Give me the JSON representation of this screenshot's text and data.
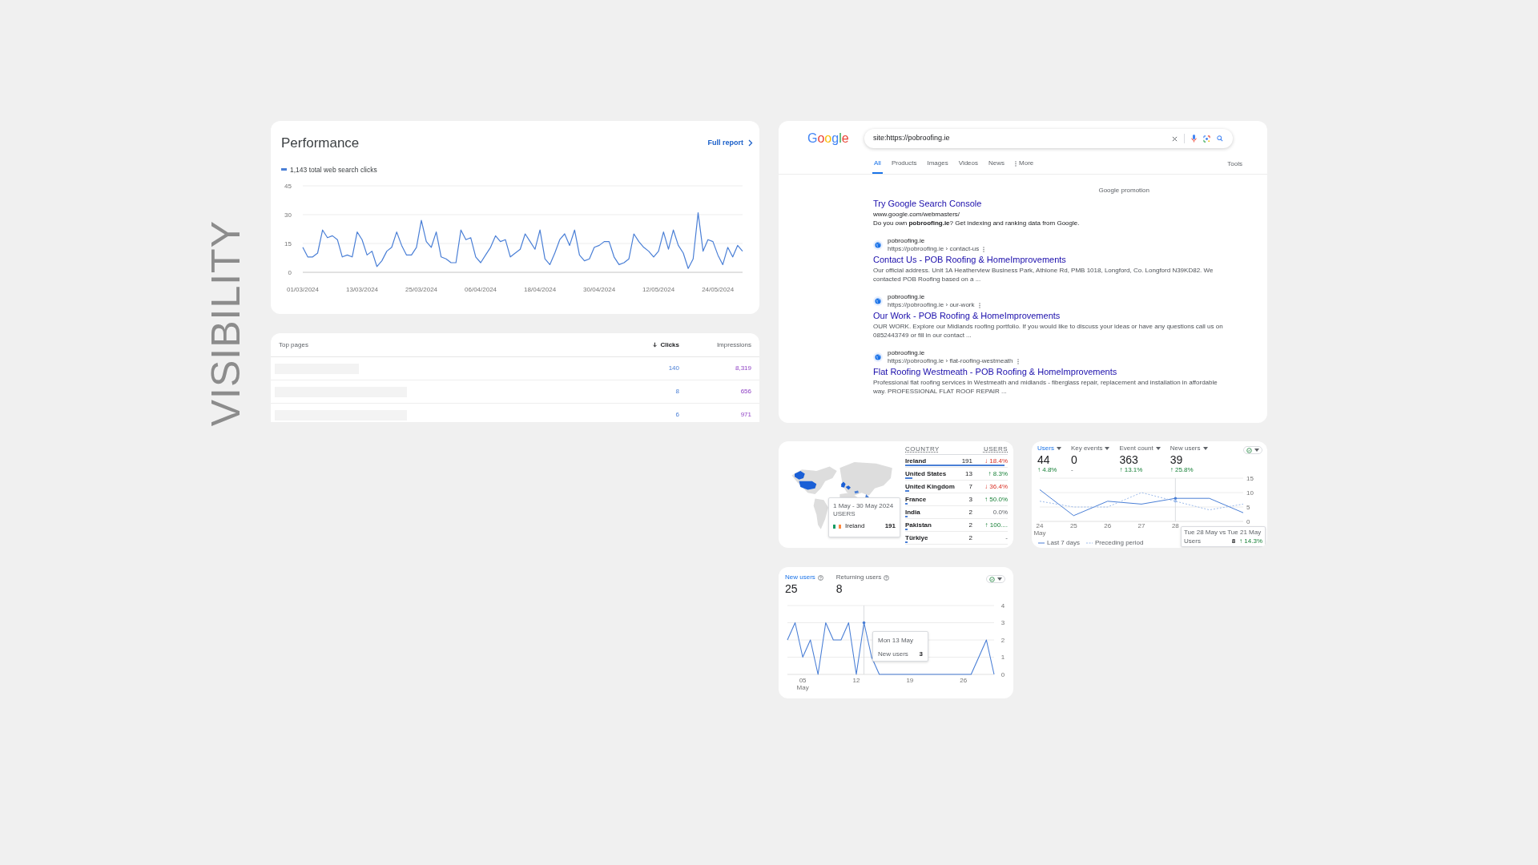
{
  "heading": "VISIBILITY",
  "performance": {
    "title": "Performance",
    "link": "Full report",
    "legend": "1,143 total web search clicks",
    "chart_data": {
      "type": "line",
      "grid": true,
      "categories": [
        "01/03/2024",
        null,
        null,
        null,
        null,
        null,
        null,
        null,
        null,
        null,
        null,
        null,
        "13/03/2024",
        null,
        null,
        null,
        null,
        null,
        null,
        null,
        null,
        null,
        null,
        null,
        "25/03/2024",
        null,
        null,
        null,
        null,
        null,
        null,
        null,
        null,
        null,
        null,
        null,
        "06/04/2024",
        null,
        null,
        null,
        null,
        null,
        null,
        null,
        null,
        null,
        null,
        null,
        "18/04/2024",
        null,
        null,
        null,
        null,
        null,
        null,
        null,
        null,
        null,
        null,
        null,
        "30/04/2024",
        null,
        null,
        null,
        null,
        null,
        null,
        null,
        null,
        null,
        null,
        null,
        "12/05/2024",
        null,
        null,
        null,
        null,
        null,
        null,
        null,
        null,
        null,
        null,
        null,
        "24/05/2024",
        null,
        null,
        null,
        null,
        null
      ],
      "series": [
        {
          "color": "#4a7fd6",
          "values": [
            13,
            8,
            8,
            10,
            22,
            18,
            19,
            17,
            8,
            9,
            8,
            21,
            17,
            9,
            11,
            3,
            6,
            11,
            13,
            21,
            14,
            9,
            9,
            13,
            27,
            16,
            13,
            21,
            8,
            7,
            5,
            5,
            22,
            17,
            18,
            8,
            5,
            9,
            13,
            19,
            16,
            17,
            8,
            10,
            12,
            20,
            16,
            12,
            22,
            7,
            4,
            10,
            17,
            20,
            14,
            22,
            9,
            6,
            7,
            13,
            14,
            16,
            16,
            8,
            4,
            5,
            7,
            20,
            16,
            13,
            11,
            8,
            11,
            21,
            12,
            22,
            14,
            10,
            2,
            7,
            31,
            11,
            17,
            16,
            9,
            4,
            13,
            8,
            14,
            11
          ]
        }
      ],
      "ylim": [
        0,
        45
      ],
      "yticks": [
        0,
        15,
        30,
        45
      ]
    }
  },
  "top_pages": {
    "columns": [
      {
        "label": "Top pages",
        "sorted": false
      },
      {
        "label": "Clicks",
        "sorted": true
      },
      {
        "label": "Impressions",
        "sorted": false
      }
    ],
    "rows": [
      {
        "clicks": "140",
        "impressions": "8,319"
      },
      {
        "clicks": "8",
        "impressions": "656"
      },
      {
        "clicks": "6",
        "impressions": "971"
      }
    ]
  },
  "search": {
    "logo": "Google",
    "query": "site:https://pobroofing.ie",
    "tabs": [
      {
        "label": "All",
        "selected": true,
        "kind": "tab"
      },
      {
        "label": "Products",
        "selected": false,
        "kind": "tab"
      },
      {
        "label": "Images",
        "selected": false,
        "kind": "tab"
      },
      {
        "label": "Videos",
        "selected": false,
        "kind": "tab"
      },
      {
        "label": "News",
        "selected": false,
        "kind": "tab"
      },
      {
        "label": "More",
        "selected": false,
        "kind": "menu"
      }
    ],
    "tools": "Tools",
    "promotion": {
      "label": "Google promotion",
      "title": "Try Google Search Console",
      "url": "www.google.com/webmasters/",
      "snippet": "Do you own **pobroofing.ie**? Get indexing and ranking data from Google."
    },
    "results": [
      {
        "site": "pobroofing.ie",
        "url": "https://pobroofing.ie › contact-us",
        "title": "Contact Us - POB Roofing & HomeImprovements",
        "snippet": "Our official address. Unit 1A Heatherview Business Park, Athlone Rd, PMB 1018, Longford, Co. Longford N39KD82. We contacted POB Roofing based on a ..."
      },
      {
        "site": "pobroofing.ie",
        "url": "https://pobroofing.ie › our-work",
        "title": "Our Work - POB Roofing & HomeImprovements",
        "snippet": "OUR WORK. Explore our Midlands roofing portfolio. If you would like to discuss your ideas or have any questions call us on 0852443749 or fill in our contact ..."
      },
      {
        "site": "pobroofing.ie",
        "url": "https://pobroofing.ie › flat-roofing-westmeath",
        "title": "Flat Roofing Westmeath - POB Roofing & HomeImprovements",
        "snippet": "Professional flat roofing services in Westmeath and midlands - fiberglass repair, replacement and installation in affordable way. PROFESSIONAL FLAT ROOF REPAIR ..."
      }
    ]
  },
  "countries": {
    "columns": [
      "COUNTRY",
      "USERS"
    ],
    "rows": [
      {
        "name": "Ireland",
        "users": "191",
        "change": "↓ 18.4%",
        "rising": false,
        "falling": true,
        "level": 0.97
      },
      {
        "name": "United States",
        "users": "13",
        "change": "↑ 8.3%",
        "rising": true,
        "falling": false,
        "level": 0.07
      },
      {
        "name": "United Kingdom",
        "users": "7",
        "change": "↓ 36.4%",
        "rising": false,
        "falling": true,
        "level": 0.04
      },
      {
        "name": "France",
        "users": "3",
        "change": "↑ 50.0%",
        "rising": true,
        "falling": false,
        "level": 0.02
      },
      {
        "name": "India",
        "users": "2",
        "change": "0.0%",
        "rising": false,
        "falling": false,
        "level": 0.01
      },
      {
        "name": "Pakistan",
        "users": "2",
        "change": "↑ 100....",
        "rising": true,
        "falling": false,
        "level": 0.01
      },
      {
        "name": "Türkiye",
        "users": "2",
        "change": "-",
        "rising": false,
        "falling": false,
        "level": 0.01
      }
    ],
    "tooltip": {
      "range": "1 May - 30 May 2024",
      "label": "USERS",
      "country": "Ireland",
      "value": "191"
    }
  },
  "users_overview": {
    "metrics": [
      {
        "label": "Users",
        "value": "44",
        "change": "↑ 4.8%",
        "rising": true,
        "falling": false,
        "selected": true
      },
      {
        "label": "Key events",
        "value": "0",
        "change": "-",
        "rising": false,
        "falling": false,
        "selected": false
      },
      {
        "label": "Event count",
        "value": "363",
        "change": "↑ 13.1%",
        "rising": true,
        "falling": false,
        "selected": false
      },
      {
        "label": "New users",
        "value": "39",
        "change": "↑ 25.8%",
        "rising": true,
        "falling": false,
        "selected": false
      }
    ],
    "chart_data": {
      "type": "line",
      "grid": true,
      "x": [
        24,
        25,
        26,
        27,
        28,
        29,
        30
      ],
      "series": [
        {
          "name": "Last 7 days",
          "color": "#4a7fd6",
          "values": [
            11,
            2,
            7,
            6,
            8,
            8,
            3
          ]
        },
        {
          "name": "Preceding period",
          "color": "#9dbbea",
          "line_style": "dashed",
          "values": [
            7,
            5,
            5,
            10,
            7,
            4,
            6
          ]
        }
      ],
      "xlim": [
        24,
        30
      ],
      "ylim": [
        0,
        15
      ],
      "yticks": [
        0,
        5,
        10,
        15
      ],
      "xticks": [
        {
          "value": 24,
          "label": "24 May"
        },
        {
          "value": 25,
          "label": "25"
        },
        {
          "value": 26,
          "label": "26"
        },
        {
          "value": 27,
          "label": "27"
        },
        {
          "value": 28,
          "label": "28"
        }
      ],
      "ref_lines": [
        {
          "axis": "x",
          "value": 28
        }
      ]
    },
    "tooltip": {
      "title": "Tue 28 May vs Tue 21 May",
      "label": "Users",
      "value": "8",
      "change": "↑ 14.3%",
      "rising": true,
      "falling": false
    }
  },
  "new_vs_returning": {
    "metrics": [
      {
        "label": "New users",
        "value": "25",
        "selected": true
      },
      {
        "label": "Returning users",
        "value": "8",
        "selected": false
      }
    ],
    "chart_data": {
      "type": "line",
      "grid": true,
      "x": [
        3,
        4,
        5,
        6,
        7,
        8,
        9,
        10,
        11,
        12,
        13,
        14,
        15,
        16,
        17,
        18,
        19,
        20,
        21,
        22,
        23,
        24,
        25,
        26,
        27,
        28,
        29,
        30
      ],
      "series": [
        {
          "color": "#4a7fd6",
          "values": [
            2,
            3,
            1,
            2,
            0,
            3,
            2,
            2,
            3,
            0,
            3,
            1,
            0,
            0,
            0,
            0,
            0,
            0,
            0,
            0,
            0,
            0,
            0,
            0,
            0,
            1,
            2,
            0
          ]
        }
      ],
      "xlim": [
        3,
        30
      ],
      "ylim": [
        0,
        4
      ],
      "yticks": [
        0,
        1,
        2,
        3,
        4
      ],
      "xticks": [
        {
          "value": 5,
          "label": "05 May"
        },
        {
          "value": 12,
          "label": "12"
        },
        {
          "value": 19,
          "label": "19"
        },
        {
          "value": 26,
          "label": "26"
        }
      ],
      "ref_lines": [
        {
          "axis": "x",
          "value": 13
        }
      ]
    },
    "tooltip": {
      "title": "Mon 13 May",
      "label": "New users",
      "value": "3"
    }
  }
}
